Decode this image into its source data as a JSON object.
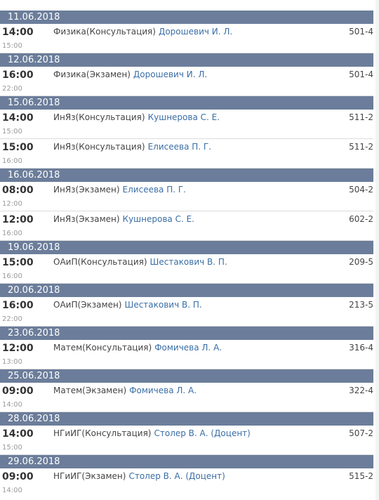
{
  "days": [
    {
      "date": "11.06.2018",
      "lessons": [
        {
          "start": "14:00",
          "end": "15:00",
          "subject": "Физика(Консультация)",
          "teacher": "Дорошевич И. Л.",
          "room": "501-4"
        }
      ]
    },
    {
      "date": "12.06.2018",
      "lessons": [
        {
          "start": "16:00",
          "end": "22:00",
          "subject": "Физика(Экзамен)",
          "teacher": "Дорошевич И. Л.",
          "room": "501-4"
        }
      ]
    },
    {
      "date": "15.06.2018",
      "lessons": [
        {
          "start": "14:00",
          "end": "15:00",
          "subject": "ИнЯз(Консультация)",
          "teacher": "Кушнерова С. Е.",
          "room": "511-2"
        },
        {
          "start": "15:00",
          "end": "16:00",
          "subject": "ИнЯз(Консультация)",
          "teacher": "Елисеева П. Г.",
          "room": "511-2"
        }
      ]
    },
    {
      "date": "16.06.2018",
      "lessons": [
        {
          "start": "08:00",
          "end": "12:00",
          "subject": "ИнЯз(Экзамен)",
          "teacher": "Елисеева П. Г.",
          "room": "504-2"
        },
        {
          "start": "12:00",
          "end": "16:00",
          "subject": "ИнЯз(Экзамен)",
          "teacher": "Кушнерова С. Е.",
          "room": "602-2"
        }
      ]
    },
    {
      "date": "19.06.2018",
      "lessons": [
        {
          "start": "15:00",
          "end": "16:00",
          "subject": "ОАиП(Консультация)",
          "teacher": "Шестакович В. П.",
          "room": "209-5"
        }
      ]
    },
    {
      "date": "20.06.2018",
      "lessons": [
        {
          "start": "16:00",
          "end": "22:00",
          "subject": "ОАиП(Экзамен)",
          "teacher": "Шестакович В. П.",
          "room": "213-5"
        }
      ]
    },
    {
      "date": "23.06.2018",
      "lessons": [
        {
          "start": "12:00",
          "end": "13:00",
          "subject": "Матем(Консультация)",
          "teacher": "Фомичева Л. А.",
          "room": "316-4"
        }
      ]
    },
    {
      "date": "25.06.2018",
      "lessons": [
        {
          "start": "09:00",
          "end": "14:00",
          "subject": "Матем(Экзамен)",
          "teacher": "Фомичева Л. А.",
          "room": "322-4"
        }
      ]
    },
    {
      "date": "28.06.2018",
      "lessons": [
        {
          "start": "14:00",
          "end": "15:00",
          "subject": "НГиИГ(Консультация)",
          "teacher": "Столер В. А. (Доцент)",
          "room": "507-2"
        }
      ]
    },
    {
      "date": "29.06.2018",
      "lessons": [
        {
          "start": "09:00",
          "end": "14:00",
          "subject": "НГиИГ(Экзамен)",
          "teacher": "Столер В. А. (Доцент)",
          "room": "515-2"
        }
      ]
    }
  ]
}
